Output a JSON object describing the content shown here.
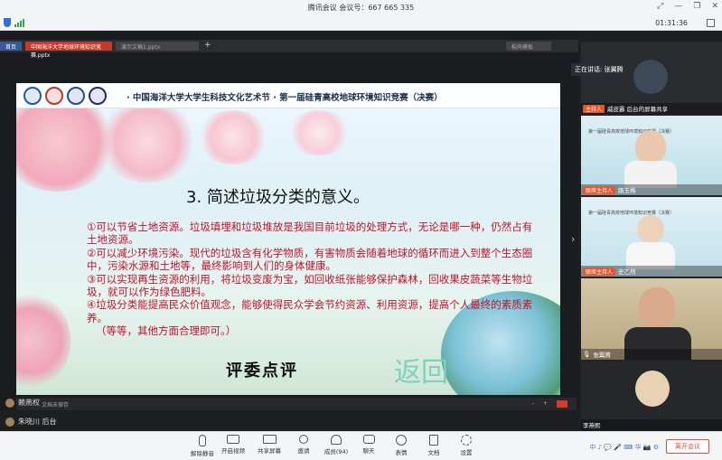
{
  "window": {
    "title": "腾讯会议 会议号：667 665 335",
    "timer": "01:31:36"
  },
  "ppt_tabs": {
    "tab1": "首页",
    "tab2": "中国海洋大学地球环境知识竞赛.pptx",
    "tab3": "演示文稿1.pptx",
    "tab4": "稻壳模板"
  },
  "slide": {
    "header": "· 中国海洋大学大学生科技文化艺术节 · 第一届硅青高校地球环境知识竞赛（决赛）",
    "title": "3. 简述垃圾分类的意义。",
    "points": [
      "①可以节省土地资源。垃圾填埋和垃圾堆放是我国目前垃圾的处理方式，无论是哪一种，仍然占有土地资源。",
      "②可以减少环境污染。现代的垃圾含有化学物质，有害物质会随着地球的循环而进入到整个生态圈中，污染水源和土地等，最终影响到人们的身体健康。",
      "③可以实现再生资源的利用，将垃圾变废为宝，如回收纸张能够保护森林，回收果皮蔬菜等生物垃圾，就可以作为绿色肥料。",
      "④垃圾分类能提高民众价值观念，能够使得民众学会节约资源、利用资源，提高个人最终的素质素养。",
      "（等等，其他方面合理即可。）"
    ],
    "review": "评委点评",
    "back": "返回"
  },
  "slide_nav": {
    "left": "文档未保存",
    "zoom": "-",
    "page": "+"
  },
  "participants": [
    {
      "name": "赖燕权"
    },
    {
      "name": "朱晓川 后台"
    }
  ],
  "video": {
    "speaking": "正在讲话: 张翼腾",
    "tiles": [
      {
        "host": "主持人",
        "name": "戚皮霸 后台的屏幕共享"
      },
      {
        "host": "联席主持人",
        "name": "路玉格"
      },
      {
        "host": "联席主持人",
        "name": "史乙然"
      },
      {
        "host": "",
        "name": "张翼腾"
      },
      {
        "host": "",
        "name": "李燕熙"
      }
    ],
    "mini_slide_line": "第一届硅青高校地球环境知识竞赛（决赛）"
  },
  "toolbar": {
    "buttons": [
      {
        "label": "解除静音",
        "icon": "mic-muted-icon"
      },
      {
        "label": "开启视频",
        "icon": "camera-off-icon"
      },
      {
        "label": "共享屏幕",
        "icon": "share-screen-icon"
      },
      {
        "label": "邀请",
        "icon": "invite-icon"
      },
      {
        "label": "成员(94)",
        "icon": "members-icon"
      },
      {
        "label": "聊天",
        "icon": "chat-icon"
      },
      {
        "label": "表情",
        "icon": "emoji-icon"
      },
      {
        "label": "文档",
        "icon": "document-icon"
      },
      {
        "label": "设置",
        "icon": "settings-icon"
      }
    ],
    "leave": "离开会议",
    "watermark": "中 ♪ 💬 🎤 ⌨ 华 📷 ⚙"
  },
  "colors": {
    "accent": "#e2572f",
    "slide_text": "#c0132b",
    "leave": "#e04c3c"
  }
}
